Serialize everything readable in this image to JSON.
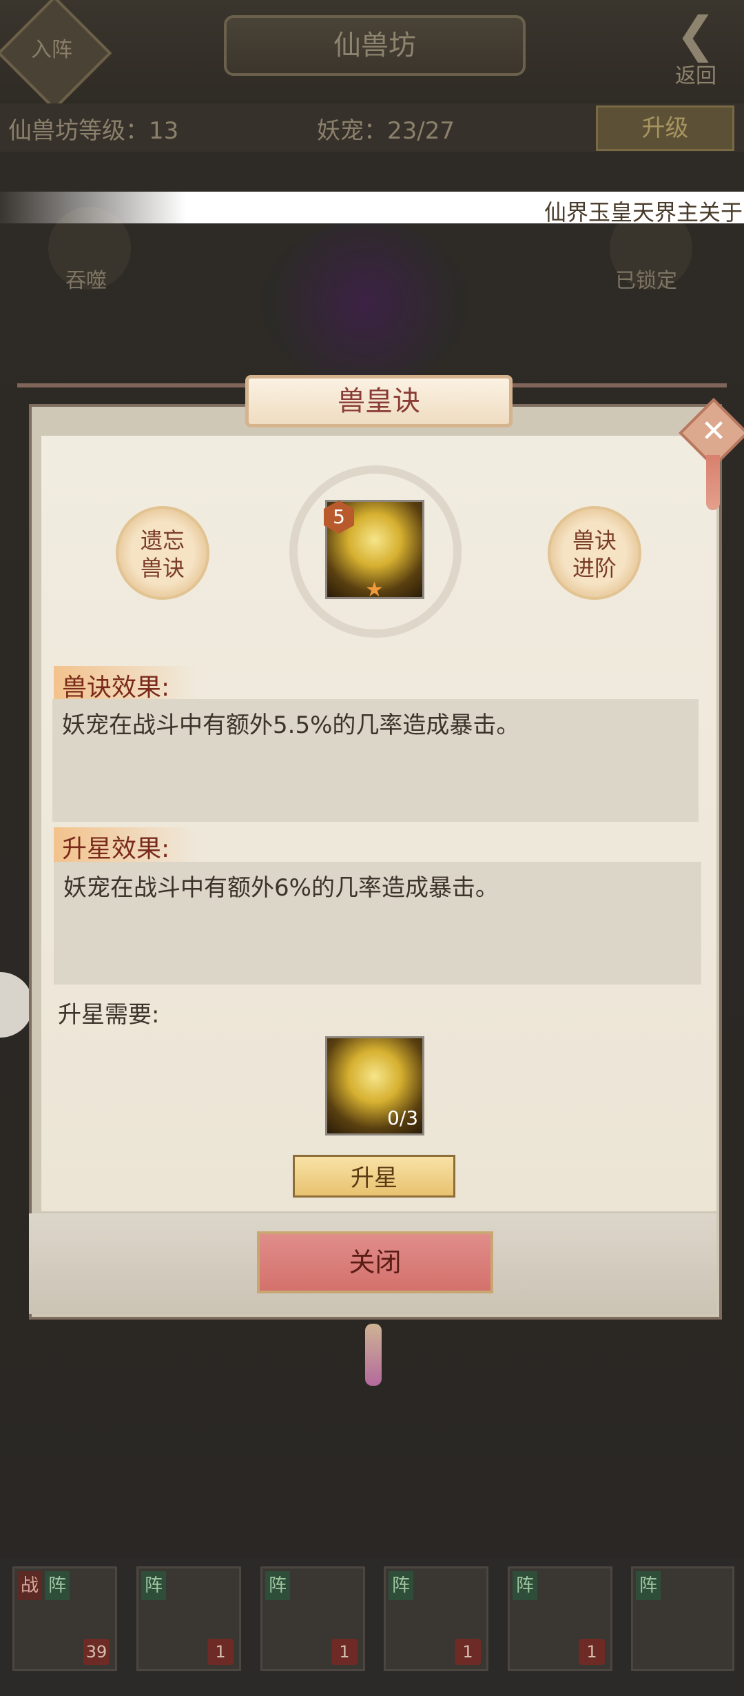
{
  "header": {
    "join_label": "入阵",
    "title": "仙兽坊",
    "back_label": "返回"
  },
  "info": {
    "level_text": "仙兽坊等级：13",
    "pets_text": "妖宠：23/27",
    "upgrade_label": "升级"
  },
  "marquee": {
    "text": "仙界玉皇天界主关于"
  },
  "side": {
    "swallow_label": "吞噬",
    "locked_label": "已锁定"
  },
  "dialog": {
    "title": "兽皇诀",
    "forget_label": "遗忘\n兽诀",
    "advance_label": "兽诀\n进阶",
    "skill_level": "5",
    "effect_title": "兽诀效果:",
    "effect_text": "妖宠在战斗中有额外5.5%的几率造成暴击。",
    "star_title": "升星效果:",
    "star_text": "妖宠在战斗中有额外6%的几率造成暴击。",
    "need_label": "升星需要:",
    "req_count": "0/3",
    "upstar_label": "升星",
    "close_label": "关闭"
  },
  "roster": [
    {
      "tag": "战",
      "tag2": "阵",
      "count": "39"
    },
    {
      "tag": "阵",
      "count": "1"
    },
    {
      "tag": "阵",
      "count": "1"
    },
    {
      "tag": "阵",
      "count": "1"
    },
    {
      "tag": "阵",
      "count": "1"
    },
    {
      "tag": "阵",
      "count": ""
    }
  ],
  "colors": {
    "accent_red": "#d4716c",
    "gold": "#e8c270",
    "parchment": "#f1ece0"
  }
}
